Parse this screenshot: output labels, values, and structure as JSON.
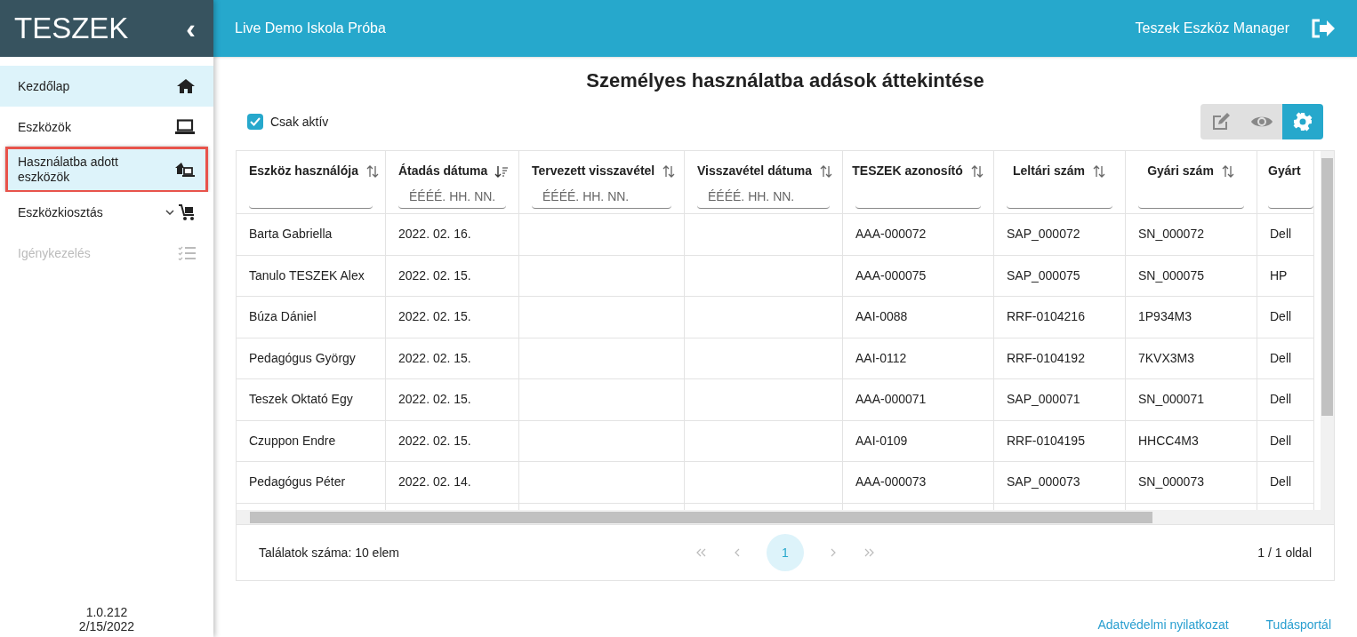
{
  "sidebar": {
    "logo": "TESZEK",
    "collapse_glyph": "‹",
    "items": [
      {
        "label": "Kezdőlap",
        "kind": "home",
        "highlighted": true,
        "outlined": false,
        "disabled": false,
        "expandable": false
      },
      {
        "label": "Eszközök",
        "kind": "devices",
        "highlighted": false,
        "outlined": false,
        "disabled": false,
        "expandable": false
      },
      {
        "label": "Használatba adott eszközök",
        "kind": "loans",
        "highlighted": true,
        "outlined": true,
        "disabled": false,
        "expandable": false
      },
      {
        "label": "Eszközkiosztás",
        "kind": "distribution",
        "highlighted": false,
        "outlined": false,
        "disabled": false,
        "expandable": true
      },
      {
        "label": "Igénykezelés",
        "kind": "requests",
        "highlighted": false,
        "outlined": false,
        "disabled": true,
        "expandable": false
      }
    ],
    "version": "1.0.212",
    "date": "2/15/2022"
  },
  "header": {
    "school": "Live Demo Iskola Próba",
    "app": "Teszek Eszköz Manager"
  },
  "page_title": "Személyes használatba adások áttekintése",
  "active_only": {
    "label": "Csak aktív",
    "checked": true
  },
  "view_buttons": [
    {
      "kind": "edit",
      "selected": false
    },
    {
      "kind": "view",
      "selected": false
    },
    {
      "kind": "settings",
      "selected": true
    }
  ],
  "table": {
    "columns": [
      {
        "label": "Eszköz használója",
        "sorted": false,
        "kind": "text"
      },
      {
        "label": "Átadás dátuma",
        "sorted": true,
        "kind": "date",
        "placeholder": "ÉÉÉÉ. HH. NN."
      },
      {
        "label": "Tervezett visszavétel",
        "sorted": false,
        "kind": "date",
        "placeholder": "ÉÉÉÉ. HH. NN."
      },
      {
        "label": "Visszavétel dátuma",
        "sorted": false,
        "kind": "date",
        "placeholder": "ÉÉÉÉ. HH. NN."
      },
      {
        "label": "TESZEK azonosító",
        "sorted": false,
        "kind": "text"
      },
      {
        "label": "Leltári szám",
        "sorted": false,
        "kind": "text"
      },
      {
        "label": "Gyári szám",
        "sorted": false,
        "kind": "text"
      },
      {
        "label": "Gyárt",
        "kind": "text"
      }
    ],
    "rows": [
      [
        "Barta Gabriella",
        "2022. 02. 16.",
        "",
        "",
        "AAA-000072",
        "SAP_000072",
        "SN_000072",
        "Dell"
      ],
      [
        "Tanulo TESZEK Alex",
        "2022. 02. 15.",
        "",
        "",
        "AAA-000075",
        "SAP_000075",
        "SN_000075",
        "HP"
      ],
      [
        "Búza Dániel",
        "2022. 02. 15.",
        "",
        "",
        "AAI-0088",
        "RRF-0104216",
        "1P934M3",
        "Dell"
      ],
      [
        "Pedagógus György",
        "2022. 02. 15.",
        "",
        "",
        "AAI-0112",
        "RRF-0104192",
        "7KVX3M3",
        "Dell"
      ],
      [
        "Teszek Oktató Egy",
        "2022. 02. 15.",
        "",
        "",
        "AAA-000071",
        "SAP_000071",
        "SN_000071",
        "Dell"
      ],
      [
        "Czuppon Endre",
        "2022. 02. 15.",
        "",
        "",
        "AAI-0109",
        "RRF-0104195",
        "HHCC4M3",
        "Dell"
      ],
      [
        "Pedagógus Péter",
        "2022. 02. 14.",
        "",
        "",
        "AAA-000073",
        "SAP_000073",
        "SN_000073",
        "Dell"
      ]
    ]
  },
  "footer": {
    "count": "Találatok száma: 10 elem",
    "pages": [
      {
        "label": "1",
        "selected": true
      }
    ],
    "page_info": "1 / 1 oldal"
  },
  "links": [
    "Adatvédelmi nyilatkozat",
    "Tudásportál"
  ]
}
